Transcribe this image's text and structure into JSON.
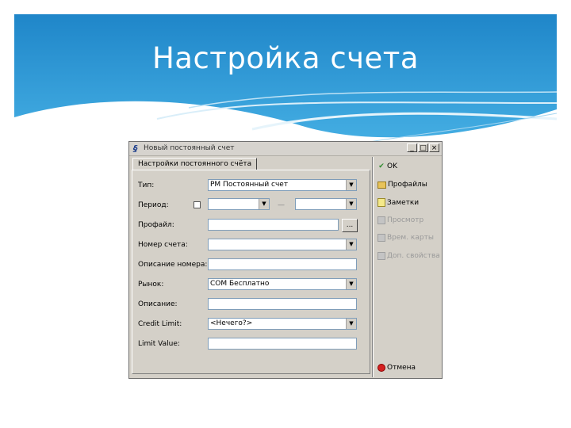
{
  "slide": {
    "title": "Настройка счета"
  },
  "window": {
    "title": "Новый постоянный счет",
    "tab": "Настройки постоянного счёта",
    "controls": [
      "_",
      "□",
      "×"
    ]
  },
  "form": {
    "type_label": "Тип:",
    "type_value": "PM Постоянный счет",
    "period_label": "Период:",
    "period_dash": "—",
    "profile_label": "Профайл:",
    "profile_button": "...",
    "account_number_label": "Номер счета:",
    "number_description_label": "Описание номера:",
    "market_label": "Рынок:",
    "market_value": "COM Бесплатно",
    "description_label": "Описание:",
    "credit_limit_label": "Credit Limit:",
    "credit_limit_value": "<Нечего?>",
    "limit_value_label": "Limit Value:"
  },
  "actions": {
    "ok": "OK",
    "profiles": "Профайлы",
    "notes": "Заметки",
    "view": "Просмотр",
    "cards": "Врем. карты",
    "additional": "Доп. свойства",
    "cancel": "Отмена"
  },
  "colors": {
    "banner": "#2f9fd8",
    "dialog_face": "#d4d0c8",
    "ok_icon": "#2e8b2e",
    "cancel_icon": "#d42020"
  }
}
